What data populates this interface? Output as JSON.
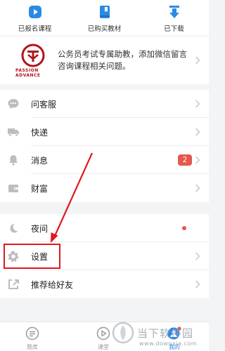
{
  "top_bar": {
    "items": [
      {
        "label": "已报名课程",
        "icon": "play-icon"
      },
      {
        "label": "已购买教材",
        "icon": "book-icon"
      },
      {
        "label": "已下载",
        "icon": "download-icon"
      }
    ]
  },
  "banner": {
    "logo_text": "PASSION ADVANCE",
    "text": "公务员考试专属助教，添加微信留言咨询课程相关问题。"
  },
  "menu": {
    "group1": [
      {
        "label": "问客服",
        "icon": "chat-icon"
      },
      {
        "label": "快递",
        "icon": "truck-icon"
      },
      {
        "label": "消息",
        "icon": "bell-icon",
        "badge": "2"
      },
      {
        "label": "财富",
        "icon": "wallet-icon"
      }
    ],
    "group2": [
      {
        "label": "夜间",
        "icon": "moon-icon",
        "dot": true
      },
      {
        "label": "设置",
        "icon": "gear-icon"
      },
      {
        "label": "推荐给好友",
        "icon": "share-icon"
      }
    ]
  },
  "tab_bar": {
    "tabs": [
      {
        "label": "题库",
        "icon": "list-icon"
      },
      {
        "label": "课堂",
        "icon": "class-icon"
      },
      {
        "label": "我的",
        "icon": "profile-icon",
        "active": true
      }
    ]
  },
  "watermark": {
    "text": "当下软件园",
    "url": "www.downxia.com"
  },
  "colors": {
    "accent": "#2a8be6",
    "badge": "#e4574d",
    "highlight": "#e0181f"
  }
}
